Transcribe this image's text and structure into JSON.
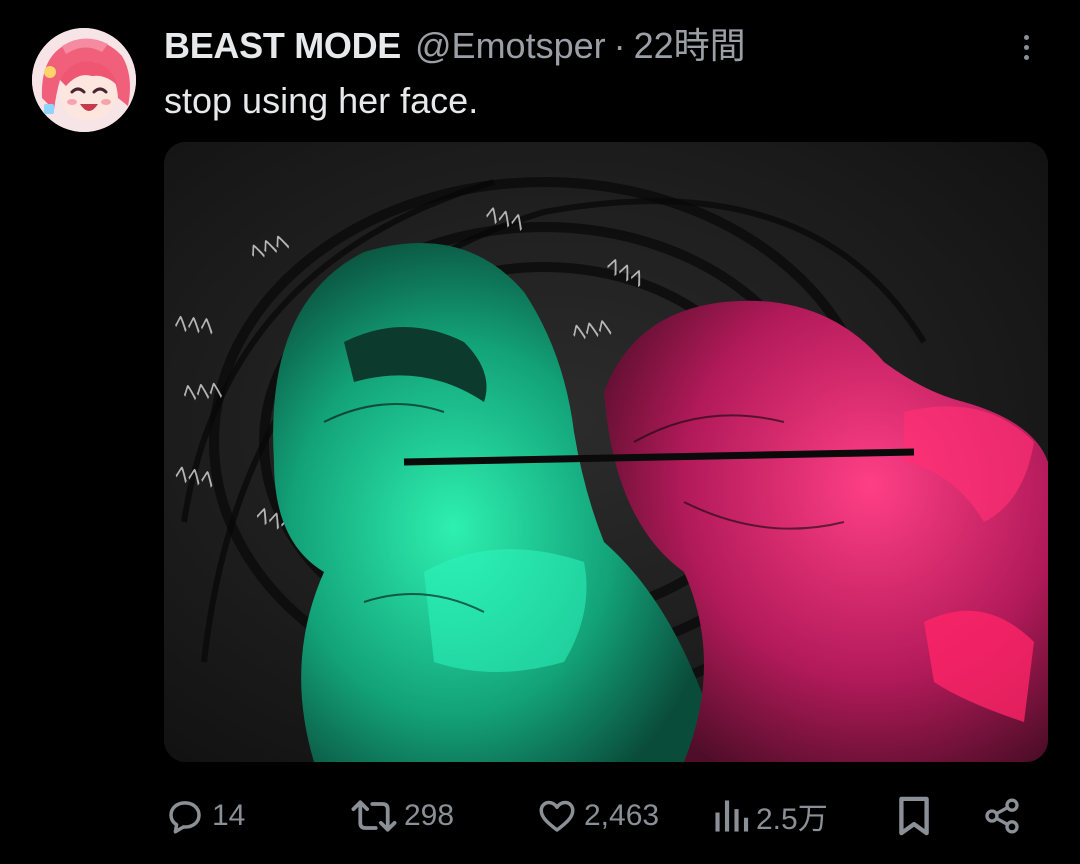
{
  "tweet": {
    "display_name": "BEAST MODE",
    "handle": "@Emotsper",
    "separator": "·",
    "time_ago": "22時間",
    "text": "stop using her face."
  },
  "media": {
    "description": "illustration",
    "glyphs": "ﾍﾍﾍ"
  },
  "actions": {
    "reply": {
      "icon": "reply-icon",
      "count": "14"
    },
    "retweet": {
      "icon": "retweet-icon",
      "count": "298"
    },
    "like": {
      "icon": "heart-icon",
      "count": "2,463"
    },
    "views": {
      "icon": "views-icon",
      "count": "2.5万"
    },
    "bookmark": {
      "icon": "bookmark-icon"
    },
    "share": {
      "icon": "share-icon"
    }
  },
  "colors": {
    "background": "#000000",
    "text_primary": "#e7e9ea",
    "text_secondary": "#8b9096",
    "art_green": "#1fd9a0",
    "art_pink": "#e8327a"
  }
}
